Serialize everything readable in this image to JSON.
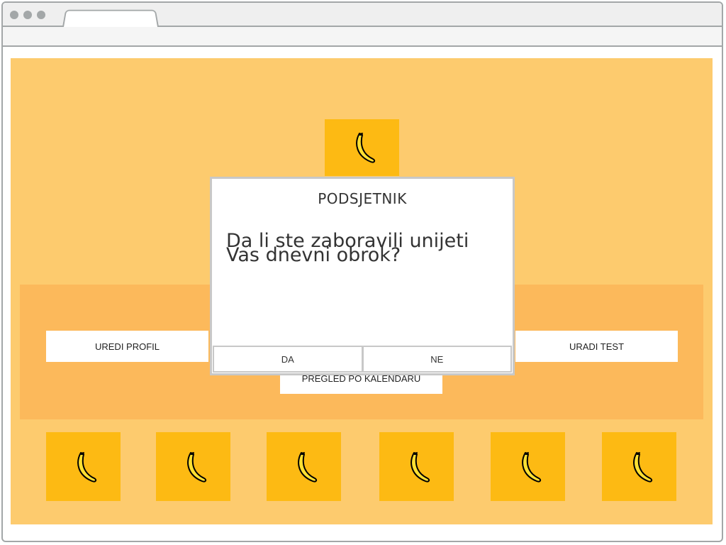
{
  "menu": {
    "edit_profile": "UREDI PROFIL",
    "take_test": "URADI TEST",
    "calendar_overview": "PREGLED PO KALENDARU"
  },
  "dialog": {
    "title": "PODSJETNIK",
    "message": "Da li ste zaboravili unijeti Vas dnevni obrok?",
    "yes_label": "DA",
    "no_label": "NE"
  },
  "icons": {
    "tile_icon": "banana-icon"
  },
  "colors": {
    "page_background": "#fdcb6e",
    "band_background": "#fcb95b",
    "tile_background": "#fdba13",
    "banana_fill": "#ffe033"
  }
}
